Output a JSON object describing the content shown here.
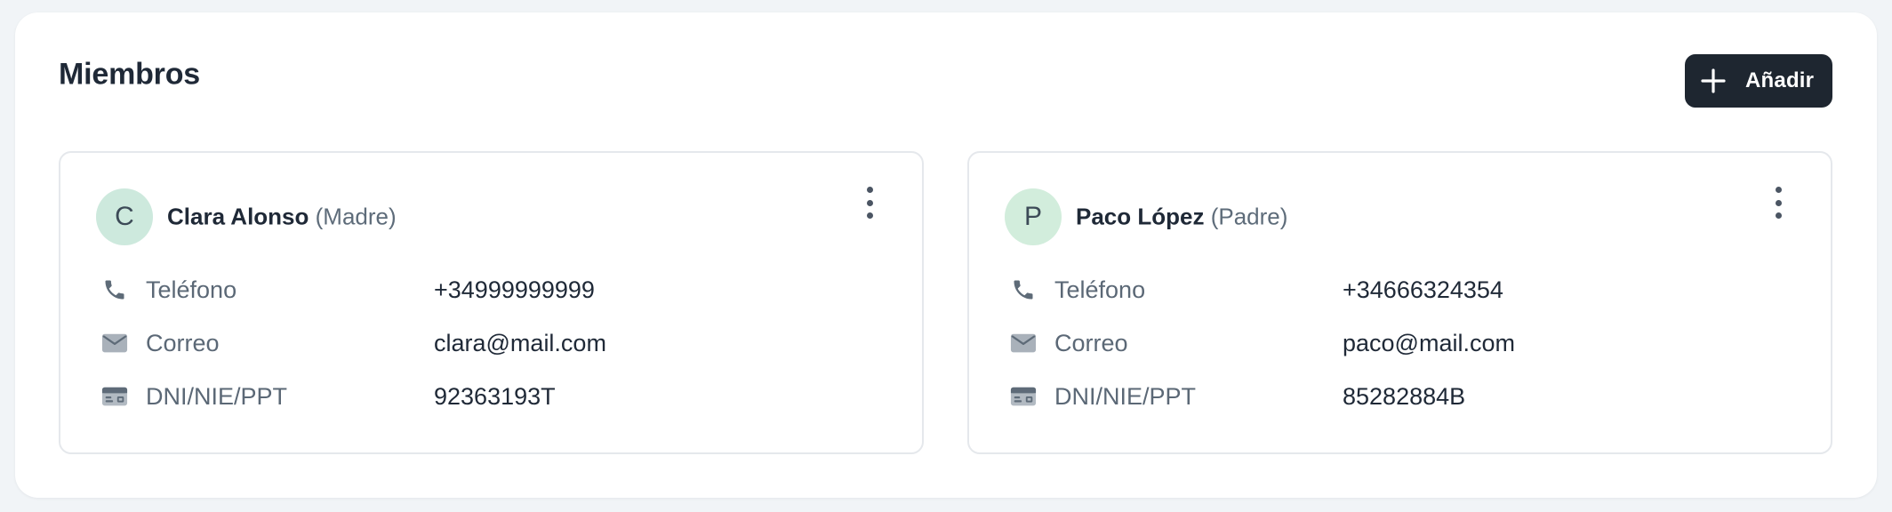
{
  "section": {
    "title": "Miembros",
    "add_button_label": "Añadir"
  },
  "members": [
    {
      "initial": "C",
      "avatar_color": "#cde9dd",
      "name": "Clara Alonso",
      "role": "(Madre)",
      "fields": [
        {
          "icon": "phone-icon",
          "label": "Teléfono",
          "value": "+34999999999"
        },
        {
          "icon": "mail-icon",
          "label": "Correo",
          "value": "clara@mail.com"
        },
        {
          "icon": "id-card-icon",
          "label": "DNI/NIE/PPT",
          "value": "92363193T"
        }
      ]
    },
    {
      "initial": "P",
      "avatar_color": "#d2eddc",
      "name": "Paco López",
      "role": "(Padre)",
      "fields": [
        {
          "icon": "phone-icon",
          "label": "Teléfono",
          "value": "+34666324354"
        },
        {
          "icon": "mail-icon",
          "label": "Correo",
          "value": "paco@mail.com"
        },
        {
          "icon": "id-card-icon",
          "label": "DNI/NIE/PPT",
          "value": "85282884B"
        }
      ]
    }
  ],
  "colors": {
    "primary_button": "#1e2630",
    "icon_gray": "#5e6b78"
  }
}
